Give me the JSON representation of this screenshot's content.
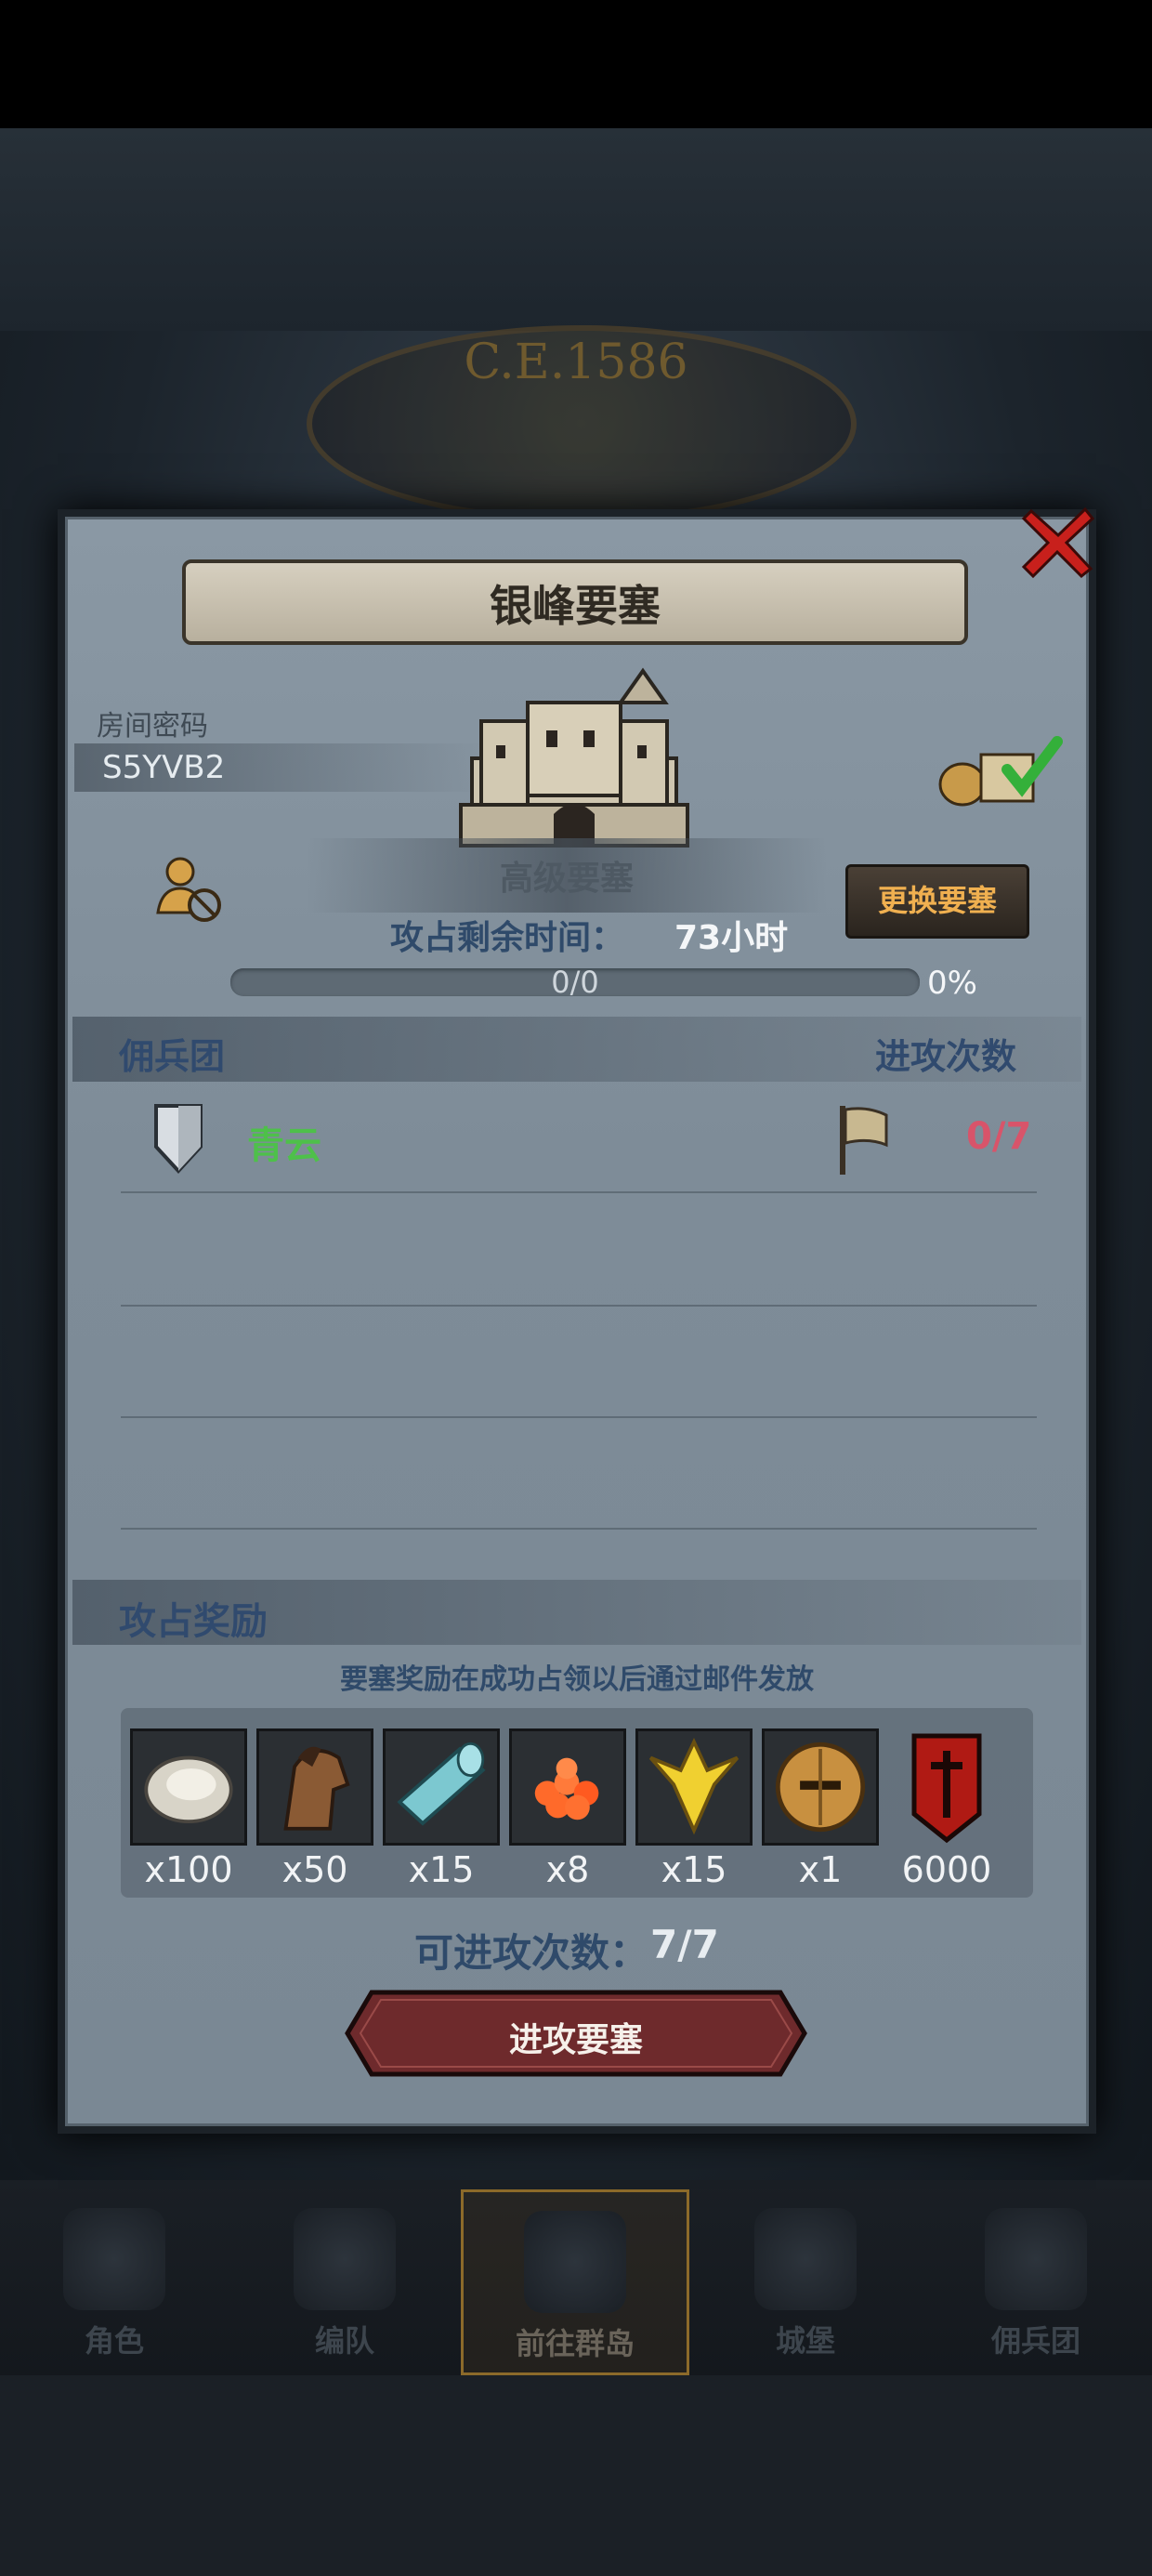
{
  "background": {
    "year": "C.E.1586"
  },
  "dialog": {
    "title": "银峰要塞",
    "room": {
      "label": "房间密码",
      "code": "S5YVB2"
    },
    "fortress_level": "高级要塞",
    "time_left": {
      "label": "攻占剩余时间：",
      "value": "73小时"
    },
    "change_button": "更换要塞",
    "progress": {
      "text": "0/0",
      "percent_text": "0%",
      "fraction": 0
    },
    "mercenary_section": {
      "label": "佣兵团",
      "attack_count_label": "进攻次数"
    },
    "mercenaries": [
      {
        "name": "青云",
        "attacks": "0/7"
      }
    ],
    "reward_section": {
      "label": "攻占奖励",
      "note": "要塞奖励在成功占领以后通过邮件发放",
      "items": [
        {
          "icon": "oyster-icon",
          "qty": "x100"
        },
        {
          "icon": "horse-icon",
          "qty": "x50"
        },
        {
          "icon": "cloth-roll-icon",
          "qty": "x15"
        },
        {
          "icon": "roe-icon",
          "qty": "x8"
        },
        {
          "icon": "gold-emblem-icon",
          "qty": "x15"
        },
        {
          "icon": "knight-helmet-icon",
          "qty": "x1"
        },
        {
          "icon": "red-banner-icon",
          "qty": "6000"
        }
      ]
    },
    "attempts": {
      "label": "可进攻次数：",
      "value": "7/7"
    },
    "attack_button": "进攻要塞"
  },
  "bottom_nav": [
    {
      "label": "角色"
    },
    {
      "label": "编队"
    },
    {
      "label": "前往群岛",
      "active": true
    },
    {
      "label": "城堡"
    },
    {
      "label": "佣兵团"
    }
  ],
  "colors": {
    "accent_green": "#4ec04a",
    "accent_red": "#d8546a",
    "button_orange": "#f0b050"
  }
}
